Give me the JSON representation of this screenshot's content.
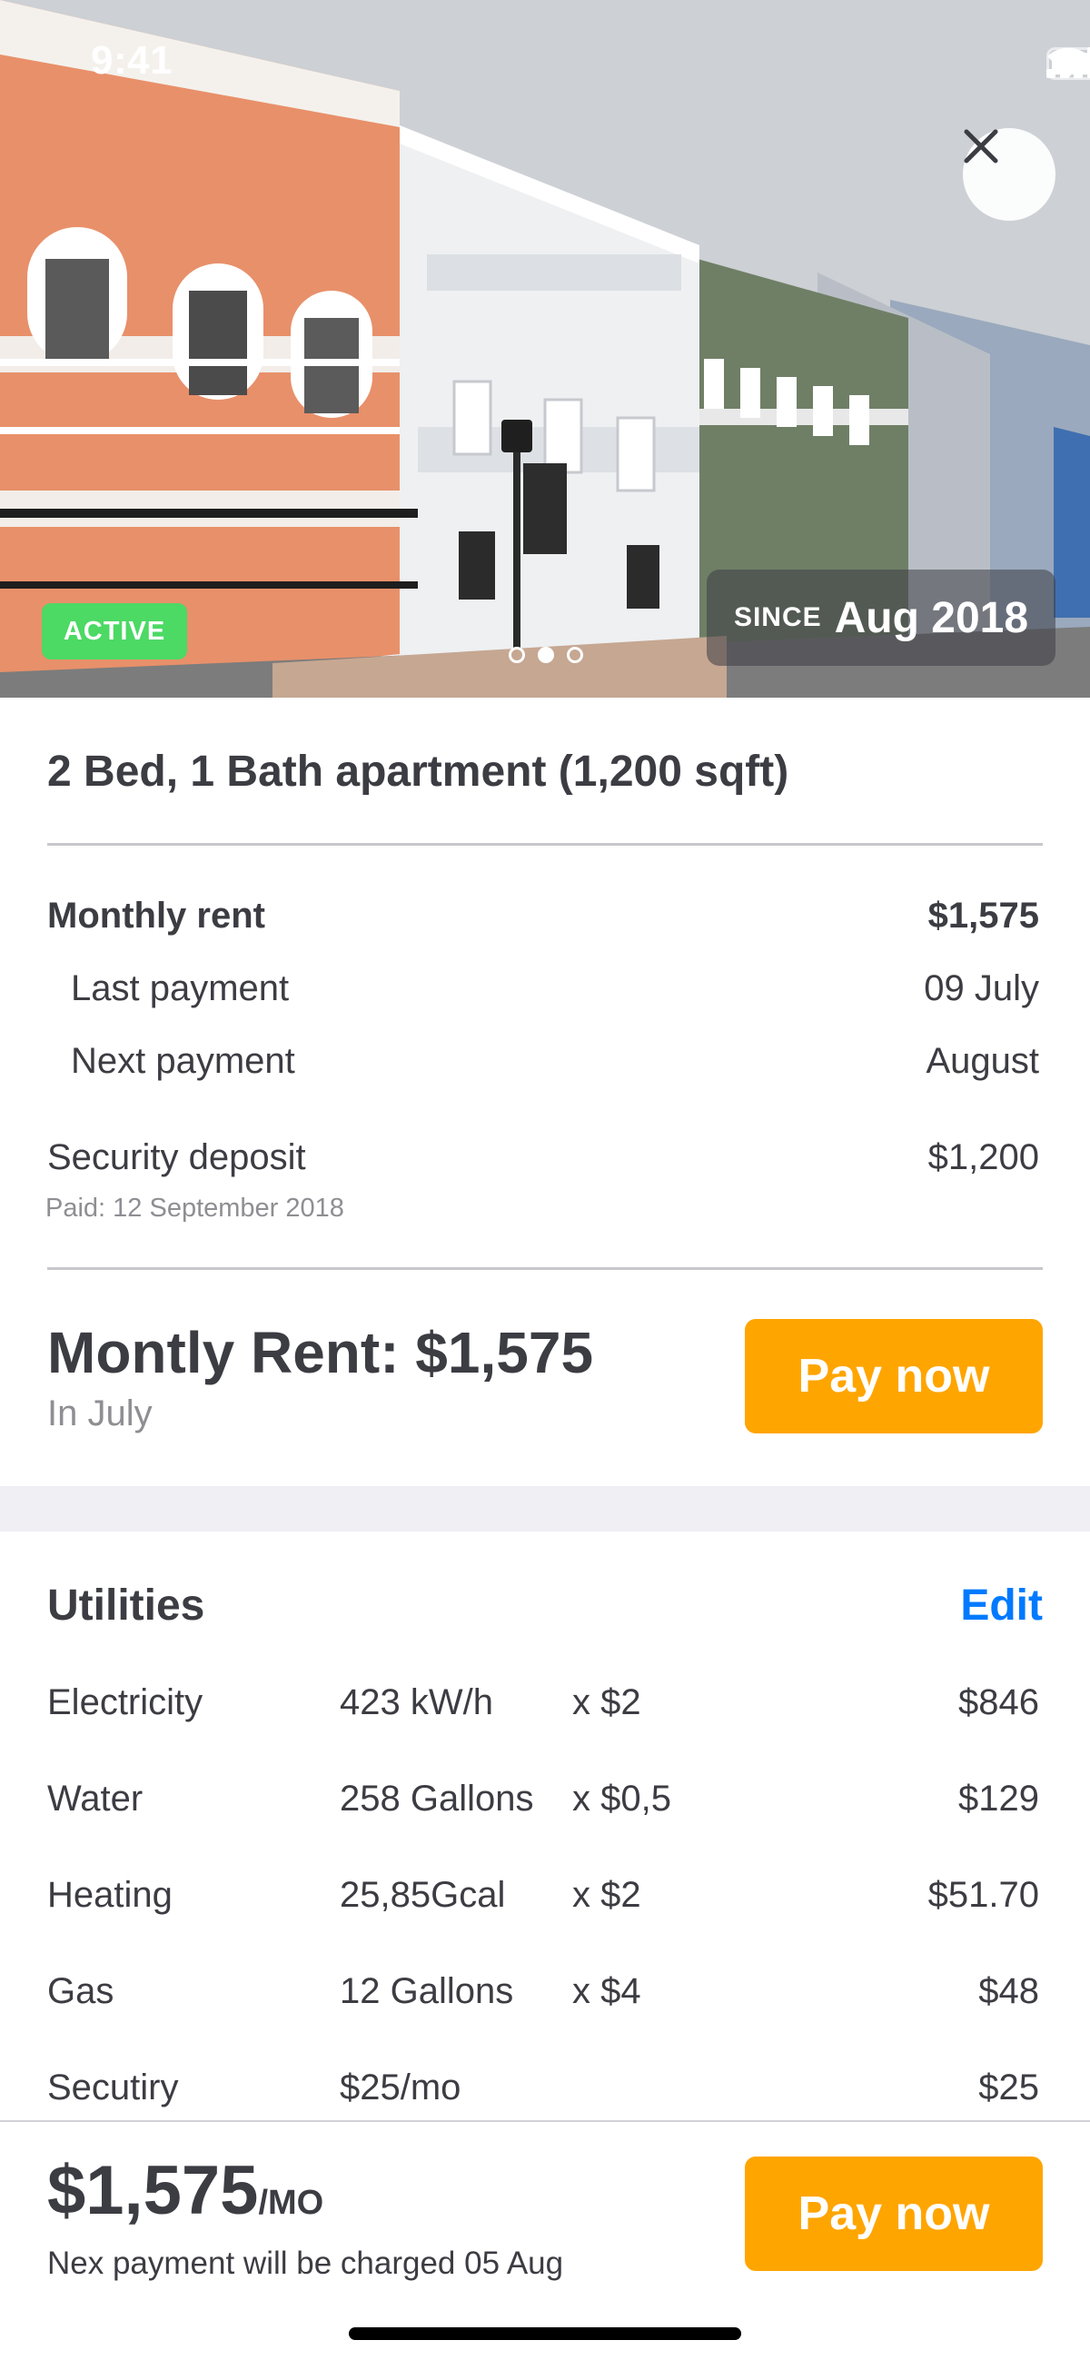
{
  "status_bar": {
    "time": "9:41"
  },
  "hero": {
    "status_badge": "ACTIVE",
    "since_label": "SINCE",
    "since_value": "Aug 2018",
    "photo_count": 3,
    "active_photo": 2
  },
  "property": {
    "summary": "2 Bed, 1 Bath apartment (1,200 sqft)"
  },
  "rent": {
    "monthly_label": "Monthly rent",
    "monthly_value": "$1,575",
    "last_label": "Last payment",
    "last_value": "09 July",
    "next_label": "Next payment",
    "next_value": "August",
    "deposit_label": "Security deposit",
    "deposit_value": "$1,200",
    "deposit_note": "Paid: 12 September 2018"
  },
  "due": {
    "title": "Montly Rent: $1,575",
    "subtitle": "In July",
    "pay_label": "Pay now"
  },
  "utilities": {
    "title": "Utilities",
    "edit_label": "Edit",
    "items": [
      {
        "name": "Electricity",
        "qty": "423 kW/h",
        "rate": "x $2",
        "total": "$846"
      },
      {
        "name": "Water",
        "qty": "258 Gallons",
        "rate": "x $0,5",
        "total": "$129"
      },
      {
        "name": "Heating",
        "qty": "25,85Gcal",
        "rate": "x $2",
        "total": "$51.70"
      },
      {
        "name": "Gas",
        "qty": "12 Gallons",
        "rate": "x $4",
        "total": "$48"
      },
      {
        "name": "Secutiry",
        "qty": "$25/mo",
        "rate": "",
        "total": "$25"
      }
    ]
  },
  "bottom": {
    "price": "$1,575",
    "per": "/MO",
    "note": "Nex payment will be charged 05 Aug",
    "pay_label": "Pay now"
  },
  "colors": {
    "accent": "#ffa500",
    "link": "#007aff",
    "active_badge": "#4cd964",
    "text": "#3c3c43",
    "secondary_text": "#8e8e93",
    "section_bg": "#efeff4"
  },
  "icons": [
    "signal-icon",
    "wifi-icon",
    "battery-icon",
    "close-icon"
  ]
}
